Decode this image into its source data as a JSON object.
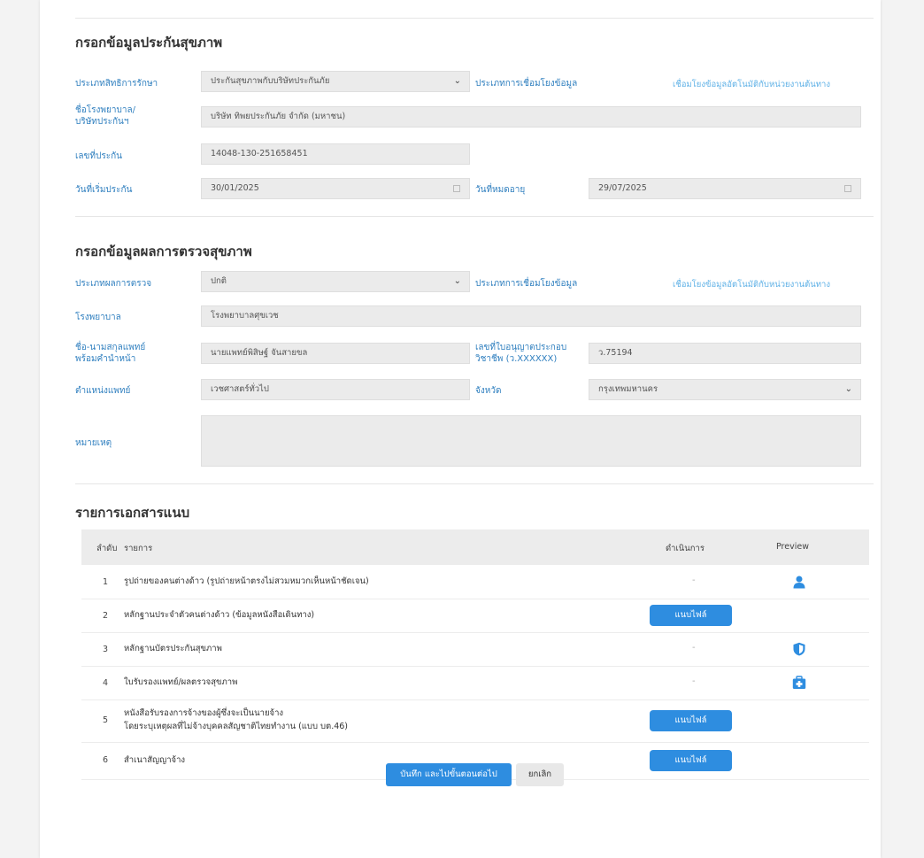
{
  "insurance": {
    "title": "กรอกข้อมูลประกันสุขภาพ",
    "rights_label": "ประเภทสิทธิการรักษา",
    "rights_value": "ประกันสุขภาพกับบริษัทประกันภัย",
    "link_label": "ประเภทการเชื่อมโยงข้อมูล",
    "link_value": "เชื่อมโยงข้อมูลอัตโนมัติกับหน่วยงานต้นทาง",
    "company_label": "ชื่อโรงพยาบาล/\nบริษัทประกันฯ",
    "company_value": "บริษัท ทิพยประกันภัย จำกัด (มหาชน)",
    "policy_label": "เลขที่ประกัน",
    "policy_value": "14048-130-251658451",
    "start_label": "วันที่เริ่มประกัน",
    "start_value": "30/01/2025",
    "end_label": "วันที่หมดอายุ",
    "end_value": "29/07/2025"
  },
  "health": {
    "title": "กรอกข้อมูลผลการตรวจสุขภาพ",
    "result_label": "ประเภทผลการตรวจ",
    "result_value": "ปกติ",
    "link_label": "ประเภทการเชื่อมโยงข้อมูล",
    "link_value": "เชื่อมโยงข้อมูลอัตโนมัติกับหน่วยงานต้นทาง",
    "hospital_label": "โรงพยาบาล",
    "hospital_value": "โรงพยาบาลศุขเวช",
    "doctor_label": "ชื่อ-นามสกุลแพทย์\nพร้อมคำนำหน้า",
    "doctor_value": "นายแพทย์พิสิษฐ์ จันสายขล",
    "license_label": "เลขที่ใบอนุญาตประกอบ\nวิชาชีพ (ว.XXXXXX)",
    "license_value": "ว.75194",
    "position_label": "ตำแหน่งแพทย์",
    "position_value": "เวชศาสตร์ทั่วไป",
    "province_label": "จังหวัด",
    "province_value": "กรุงเทพมหานคร",
    "remark_label": "หมายเหตุ",
    "remark_value": ""
  },
  "docs": {
    "title": "รายการเอกสารแนบ",
    "col_no": "ลำดับ",
    "col_item": "รายการ",
    "col_action": "ดำเนินการ",
    "col_preview": "Preview",
    "attach_label": "แนบไฟล์",
    "rows": [
      {
        "no": "1",
        "name": "รูปถ่ายของคนต่างด้าว (รูปถ่ายหน้าตรงไม่สวมหมวกเห็นหน้าชัดเจน)",
        "action": "-",
        "preview": "user-icon"
      },
      {
        "no": "2",
        "name": "หลักฐานประจำตัวคนต่างด้าว (ข้อมูลหนังสือเดินทาง)",
        "action": "attach",
        "preview": ""
      },
      {
        "no": "3",
        "name": "หลักฐานบัตรประกันสุขภาพ",
        "action": "-",
        "preview": "shield-icon"
      },
      {
        "no": "4",
        "name": "ใบรับรองแพทย์/ผลตรวจสุขภาพ",
        "action": "-",
        "preview": "medical-kit-icon"
      },
      {
        "no": "5",
        "name": "หนังสือรับรองการจ้างของผู้ซึ่งจะเป็นนายจ้าง",
        "name2": "โดยระบุเหตุผลที่ไม่จ้างบุคคลสัญชาติไทยทำงาน (แบบ บต.46)",
        "action": "attach",
        "preview": ""
      },
      {
        "no": "6",
        "name": "สำเนาสัญญาจ้าง",
        "action": "attach",
        "preview": ""
      }
    ]
  },
  "footer": {
    "save_label": "บันทึก และไปขั้นตอนต่อไป",
    "cancel_label": "ยกเลิก"
  },
  "colors": {
    "label": "#2f7fbf",
    "link": "#5db0e6",
    "primary": "#2e8de0"
  }
}
